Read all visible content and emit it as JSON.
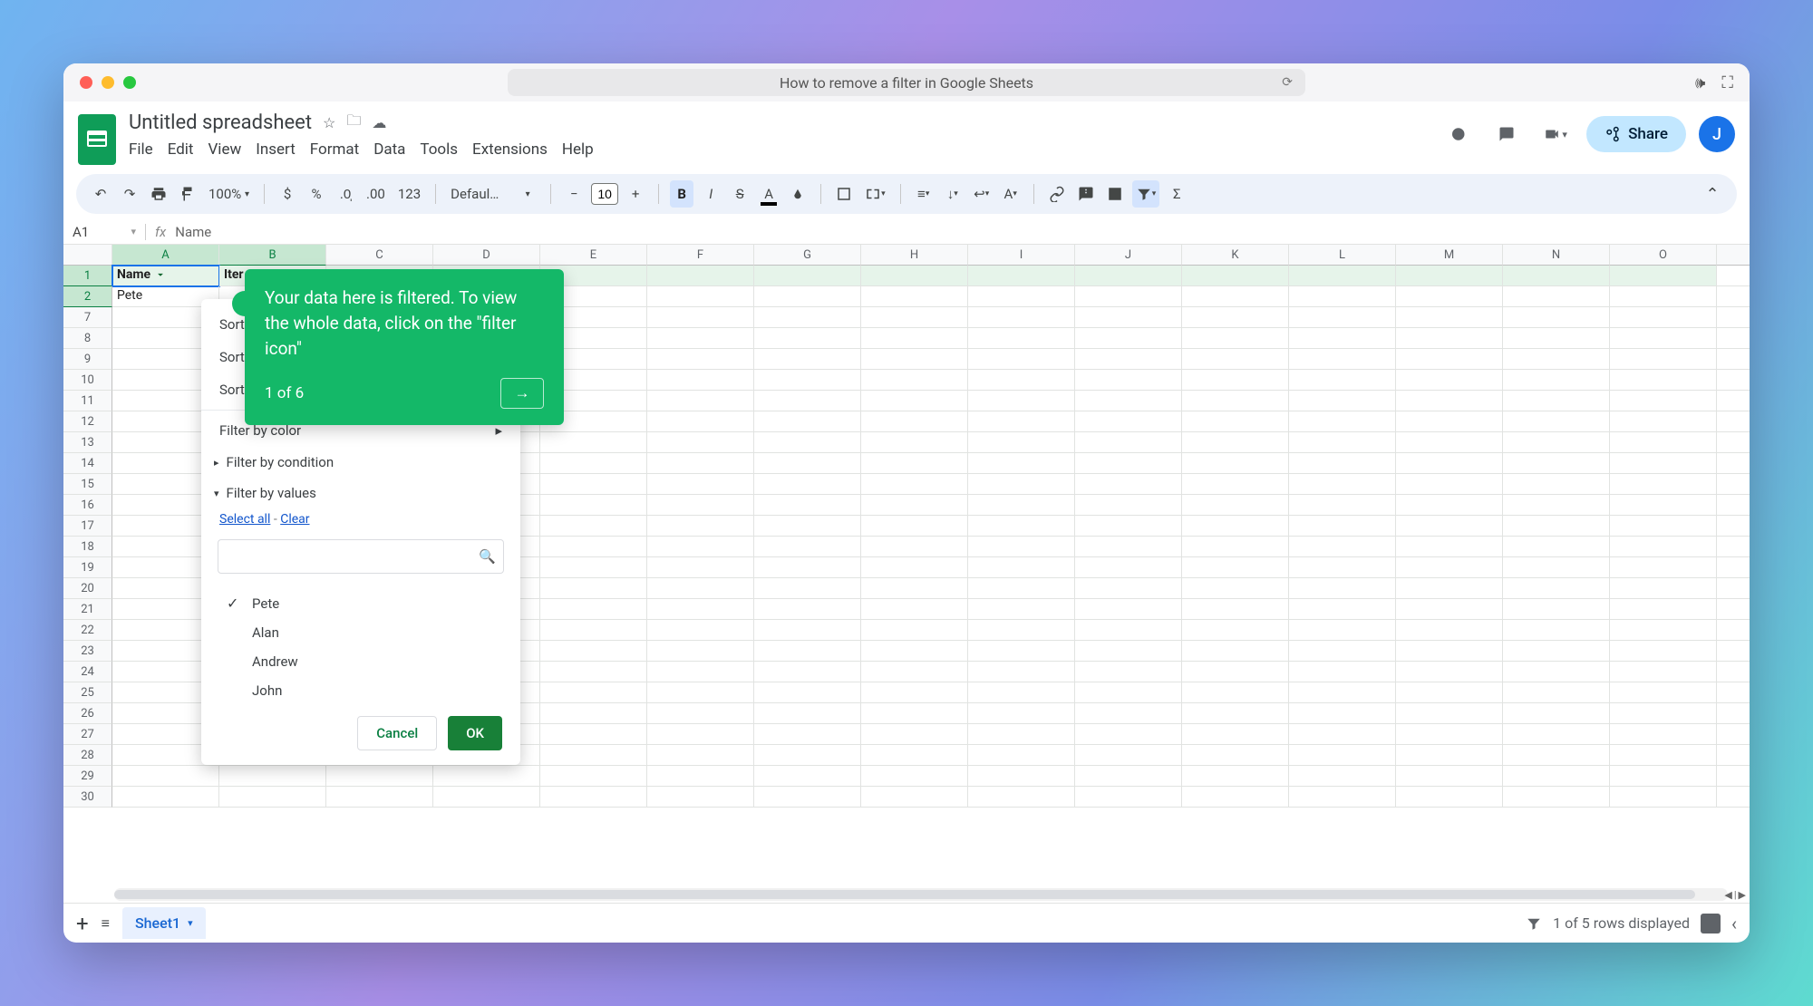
{
  "browser": {
    "title": "How to remove a filter in Google Sheets"
  },
  "doc": {
    "title": "Untitled spreadsheet",
    "menus": [
      "File",
      "Edit",
      "View",
      "Insert",
      "Format",
      "Data",
      "Tools",
      "Extensions",
      "Help"
    ],
    "share_label": "Share",
    "avatar_letter": "J"
  },
  "toolbar": {
    "zoom": "100%",
    "format_123": "123",
    "font_name": "Defaul…",
    "font_size": "10"
  },
  "namebox": {
    "ref": "A1",
    "formula": "Name"
  },
  "columns": {
    "A": "A",
    "B": "B",
    "C": "C",
    "D": "D",
    "E": "E",
    "F": "F",
    "G": "G",
    "H": "H",
    "I": "I",
    "J": "J",
    "K": "K",
    "L": "L",
    "M": "M",
    "N": "N",
    "O": "O"
  },
  "rows": [
    "1",
    "2",
    "7",
    "8",
    "9",
    "10",
    "11",
    "12",
    "13",
    "14",
    "15",
    "16",
    "17",
    "18",
    "19",
    "20",
    "21",
    "22",
    "23",
    "24",
    "25",
    "26",
    "27",
    "28",
    "29",
    "30"
  ],
  "headers": {
    "A": "Name",
    "B": "Iter"
  },
  "cells": {
    "r2A": "Pete"
  },
  "filter_menu": {
    "sort_az": "Sort A → Z",
    "sort_za": "Sort Z → A",
    "sort_color": "Sort by color",
    "filter_color": "Filter by color",
    "filter_condition": "Filter by condition",
    "filter_values": "Filter by values",
    "select_all": "Select all",
    "clear": "Clear",
    "search_placeholder": "",
    "values": [
      {
        "label": "Pete",
        "checked": true
      },
      {
        "label": "Alan",
        "checked": false
      },
      {
        "label": "Andrew",
        "checked": false
      },
      {
        "label": "John",
        "checked": false
      }
    ],
    "cancel": "Cancel",
    "ok": "OK"
  },
  "coach": {
    "text": "Your data here is filtered. To view the whole data, click on the \"filter icon\"",
    "step": "1 of 6"
  },
  "sheetbar": {
    "tab": "Sheet1",
    "status": "1 of 5 rows displayed"
  }
}
